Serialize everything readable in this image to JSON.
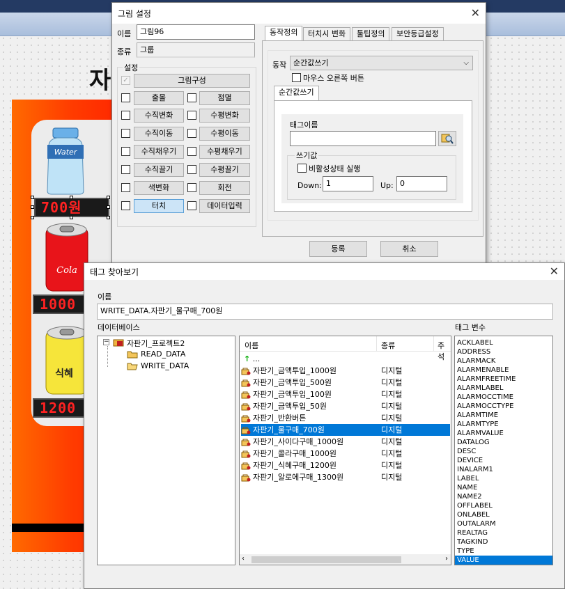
{
  "canvas": {
    "title_char": "자",
    "water_label": "Water",
    "cola_label": "Cola",
    "sikhye_label": "식혜",
    "prices": [
      "700원",
      "1000",
      "1200"
    ]
  },
  "picture_dialog": {
    "title": "그림 설정",
    "name_label": "이름",
    "name_value": "그림96",
    "type_label": "종류",
    "type_value": "그룹",
    "settings_group": "설정",
    "compose_button": "그림구성",
    "options": [
      {
        "label": "출몰",
        "checked": false
      },
      {
        "label": "점멸",
        "checked": false
      },
      {
        "label": "수직변화",
        "checked": false
      },
      {
        "label": "수평변화",
        "checked": false
      },
      {
        "label": "수직이동",
        "checked": false
      },
      {
        "label": "수평이동",
        "checked": false
      },
      {
        "label": "수직채우기",
        "checked": false
      },
      {
        "label": "수평채우기",
        "checked": false
      },
      {
        "label": "수직끌기",
        "checked": false
      },
      {
        "label": "수평끌기",
        "checked": false
      },
      {
        "label": "색변화",
        "checked": false
      },
      {
        "label": "회전",
        "checked": false
      },
      {
        "label": "터치",
        "checked": false,
        "highlighted": true
      },
      {
        "label": "데이터입력",
        "checked": false
      }
    ],
    "tabs": [
      "동작정의",
      "터치시 변화",
      "툴팁정의",
      "보안등급설정"
    ],
    "action_label": "동작",
    "action_value": "순간값쓰기",
    "mouse_right_label": "마우스 오른쪽 버튼",
    "subtab": "순간값쓰기",
    "tag_name_label": "태그이름",
    "tag_name_value": "",
    "write_value_group": "쓰기값",
    "inactive_label": "비활성상태 실행",
    "down_label": "Down:",
    "down_value": "1",
    "up_label": "Up:",
    "up_value": "0",
    "ok_button": "등록",
    "cancel_button": "취소"
  },
  "tag_dialog": {
    "title": "태그 찾아보기",
    "name_label": "이름",
    "name_value": "WRITE_DATA.자판기_물구매_700원",
    "db_label": "데이터베이스",
    "tag_var_label": "태그 변수",
    "tree": {
      "root": "자판기_프로젝트2",
      "children": [
        "READ_DATA",
        "WRITE_DATA"
      ]
    },
    "columns": [
      "이름",
      "종류",
      "주석"
    ],
    "parent_row": "...",
    "rows": [
      {
        "name": "자판기_금액투입_1000원",
        "type": "디지털"
      },
      {
        "name": "자판기_금액투입_500원",
        "type": "디지털"
      },
      {
        "name": "자판기_금액투입_100원",
        "type": "디지털"
      },
      {
        "name": "자판기_금액투입_50원",
        "type": "디지털"
      },
      {
        "name": "자판기_반환버튼",
        "type": "디지털"
      },
      {
        "name": "자판기_물구매_700원",
        "type": "디지털",
        "selected": true
      },
      {
        "name": "자판기_사이다구매_1000원",
        "type": "디지털"
      },
      {
        "name": "자판기_콜라구매_1000원",
        "type": "디지털"
      },
      {
        "name": "자판기_식혜구매_1200원",
        "type": "디지털"
      },
      {
        "name": "자판기_알로에구매_1300원",
        "type": "디지털"
      }
    ],
    "tag_vars": [
      "ACKLABEL",
      "ADDRESS",
      "ALARMACK",
      "ALARMENABLE",
      "ALARMFREETIME",
      "ALARMLABEL",
      "ALARMOCCTIME",
      "ALARMOCCTYPE",
      "ALARMTIME",
      "ALARMTYPE",
      "ALARMVALUE",
      "DATALOG",
      "DESC",
      "DEVICE",
      "INALARM1",
      "LABEL",
      "NAME",
      "NAME2",
      "OFFLABEL",
      "ONLABEL",
      "OUTALARM",
      "REALTAG",
      "TAGKIND",
      "TYPE",
      "VALUE"
    ],
    "selected_tag_var": "VALUE"
  }
}
